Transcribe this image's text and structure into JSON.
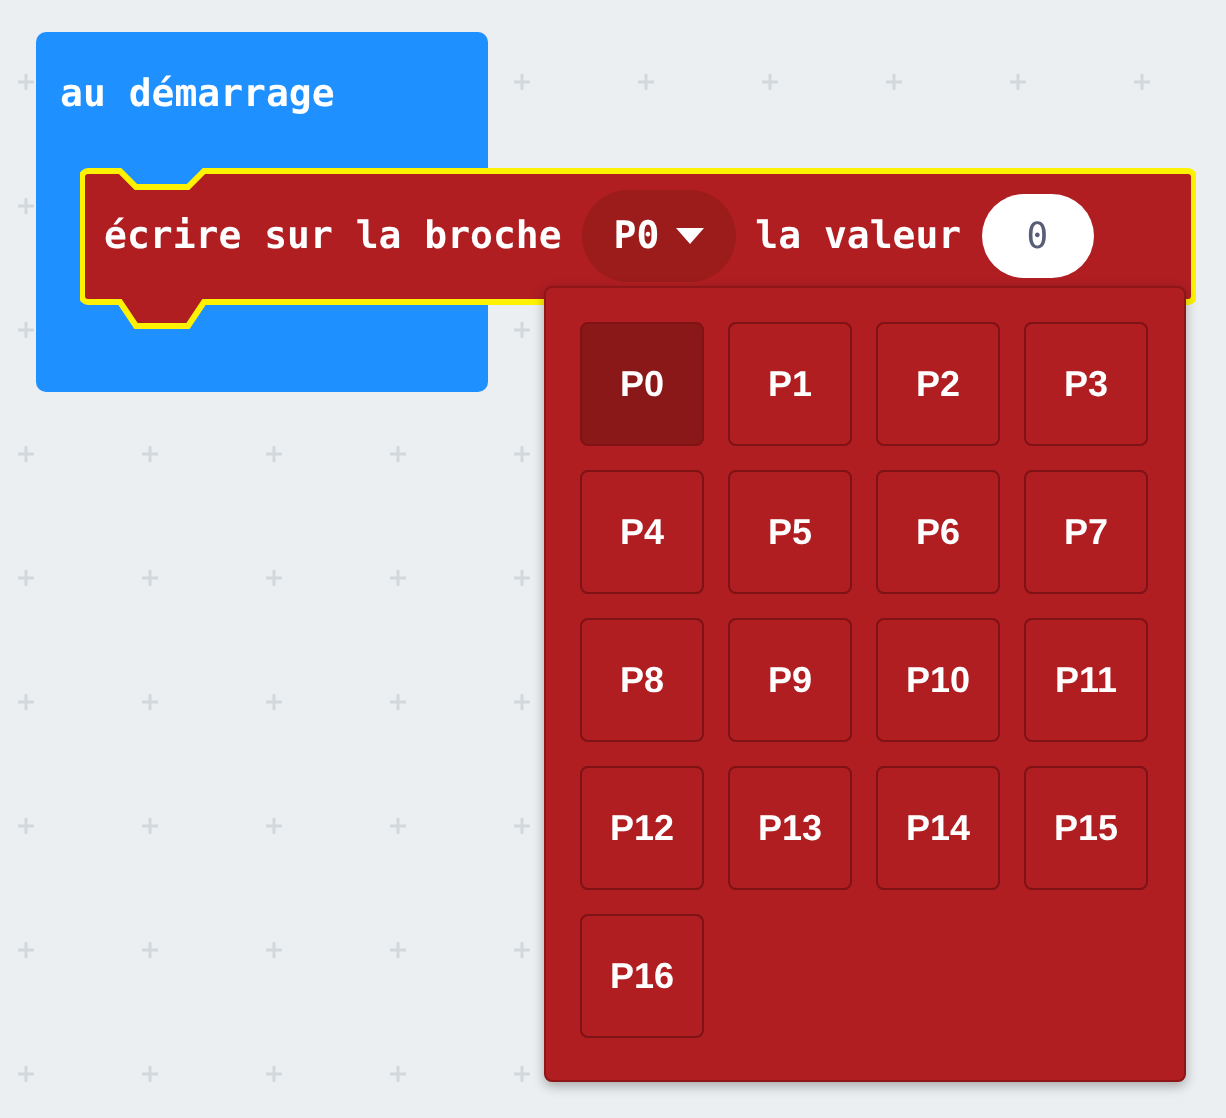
{
  "event_block": {
    "label": "au démarrage"
  },
  "statement_block": {
    "label": "écrire sur la broche",
    "pin_dropdown": {
      "value": "P0"
    },
    "value_label": "la valeur",
    "value": "0"
  },
  "pin_menu": {
    "options": [
      {
        "label": "P0",
        "selected": true
      },
      {
        "label": "P1",
        "selected": false
      },
      {
        "label": "P2",
        "selected": false
      },
      {
        "label": "P3",
        "selected": false
      },
      {
        "label": "P4",
        "selected": false
      },
      {
        "label": "P5",
        "selected": false
      },
      {
        "label": "P6",
        "selected": false
      },
      {
        "label": "P7",
        "selected": false
      },
      {
        "label": "P8",
        "selected": false
      },
      {
        "label": "P9",
        "selected": false
      },
      {
        "label": "P10",
        "selected": false
      },
      {
        "label": "P11",
        "selected": false
      },
      {
        "label": "P12",
        "selected": false
      },
      {
        "label": "P13",
        "selected": false
      },
      {
        "label": "P14",
        "selected": false
      },
      {
        "label": "P15",
        "selected": false
      },
      {
        "label": "P16",
        "selected": false
      }
    ]
  }
}
